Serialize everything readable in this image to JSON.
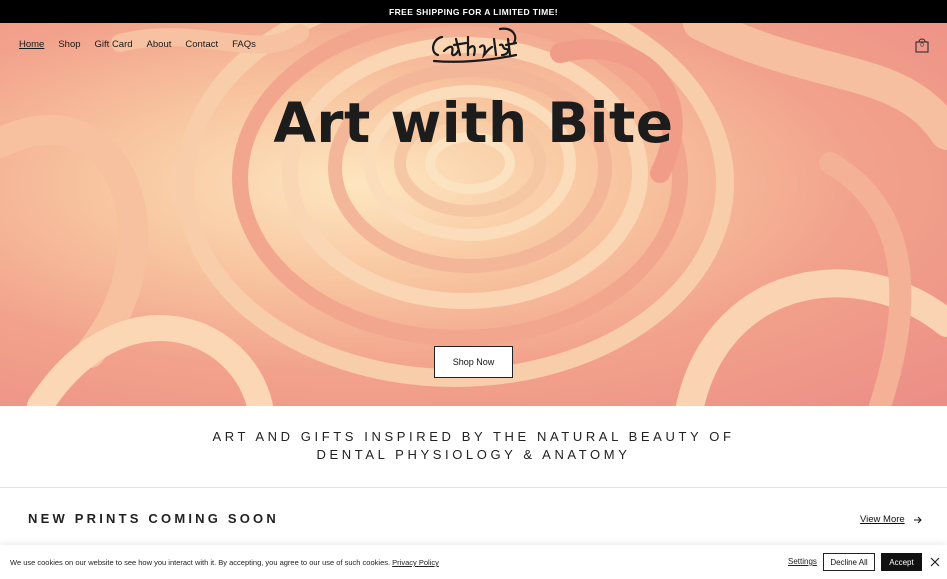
{
  "announcement": {
    "text": "FREE SHIPPING FOR A LIMITED TIME!"
  },
  "nav": {
    "items": [
      {
        "label": "Home",
        "active": true
      },
      {
        "label": "Shop"
      },
      {
        "label": "Gift Card"
      },
      {
        "label": "About"
      },
      {
        "label": "Contact"
      },
      {
        "label": "FAQs"
      }
    ]
  },
  "brand": {
    "logo_text": "Cathartistry"
  },
  "cart": {
    "count": "0",
    "icon": "shopping-bag-icon"
  },
  "hero": {
    "title": "Art with Bite",
    "button_label": "Shop Now",
    "colors": {
      "light": "#fde6c0",
      "mid": "#f8c6a0",
      "deep": "#ec8d86"
    }
  },
  "tagline": {
    "line1": "ART AND GIFTS INSPIRED BY THE NATURAL BEAUTY OF",
    "line2": "DENTAL PHYSIOLOGY & ANATOMY"
  },
  "section": {
    "title": "NEW PRINTS COMING SOON",
    "view_more": "View More"
  },
  "cookie": {
    "text": "We use cookies on our website to see how you interact with it. By accepting, you agree to our use of such cookies.",
    "policy_link": "Privacy Policy",
    "settings": "Settings",
    "decline": "Decline All",
    "accept": "Accept"
  }
}
